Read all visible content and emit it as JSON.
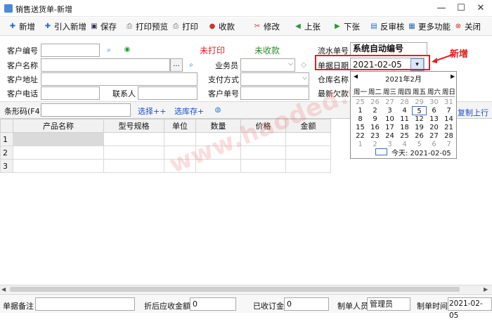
{
  "window": {
    "title": "销售送货单-新增"
  },
  "toolbar": {
    "new": "新增",
    "import_new": "引入新增",
    "save": "保存",
    "print_preview": "打印预览",
    "print": "打印",
    "receive": "收款",
    "modify": "修改",
    "prev": "上张",
    "next": "下张",
    "unreview": "反审核",
    "more": "更多功能",
    "close": "关闭"
  },
  "form": {
    "customer_no_label": "客户编号",
    "customer_name_label": "客户名称",
    "customer_addr_label": "客户地址",
    "customer_phone_label": "客户电话",
    "contact_label": "联系人",
    "salesman_label": "业务员",
    "payment_label": "支付方式",
    "customer_order_label": "客户单号",
    "print_status": "未打印",
    "receive_status": "未收款",
    "serial_label": "流水单号",
    "serial_value": "系统自动编号",
    "date_label": "单据日期",
    "date_value": "2021-02-05",
    "warehouse_label": "仓库名称",
    "last_debt_label": "最新欠款",
    "ellipsis": "...",
    "annotation_new": "新增"
  },
  "barcode": {
    "label": "条形码(F4)",
    "select_link": "选择++",
    "select_stock_link": "选库存+",
    "copy_line": "复制上行"
  },
  "grid": {
    "columns": [
      "产品名称",
      "型号规格",
      "单位",
      "数量",
      "价格",
      "金额"
    ],
    "rows": [
      "1",
      "2",
      "3"
    ]
  },
  "calendar": {
    "month_label": "2021年2月",
    "weekdays": [
      "周一",
      "周二",
      "周三",
      "周四",
      "周五",
      "周六",
      "周日"
    ],
    "weeks": [
      [
        "25",
        "26",
        "27",
        "28",
        "29",
        "30",
        "31"
      ],
      [
        "1",
        "2",
        "3",
        "4",
        "5",
        "6",
        "7"
      ],
      [
        "8",
        "9",
        "10",
        "11",
        "12",
        "13",
        "14"
      ],
      [
        "15",
        "16",
        "17",
        "18",
        "19",
        "20",
        "21"
      ],
      [
        "22",
        "23",
        "24",
        "25",
        "26",
        "27",
        "28"
      ],
      [
        "1",
        "2",
        "3",
        "4",
        "5",
        "6",
        "7"
      ]
    ],
    "today_label": "今天: 2021-02-05"
  },
  "footer": {
    "remark_label": "单据备注",
    "discount_label": "折后应收金额",
    "discount_value": "0",
    "received_label": "已收订金",
    "received_value": "0",
    "maker_label": "制单人员",
    "maker_value": "管理员",
    "time_label": "制单时间",
    "time_value": "2021-02-05"
  },
  "watermark": "www.haoded.com",
  "colors": {
    "red": "#dd2222",
    "green": "#2a8a2a",
    "blue": "#1f4fc9"
  }
}
